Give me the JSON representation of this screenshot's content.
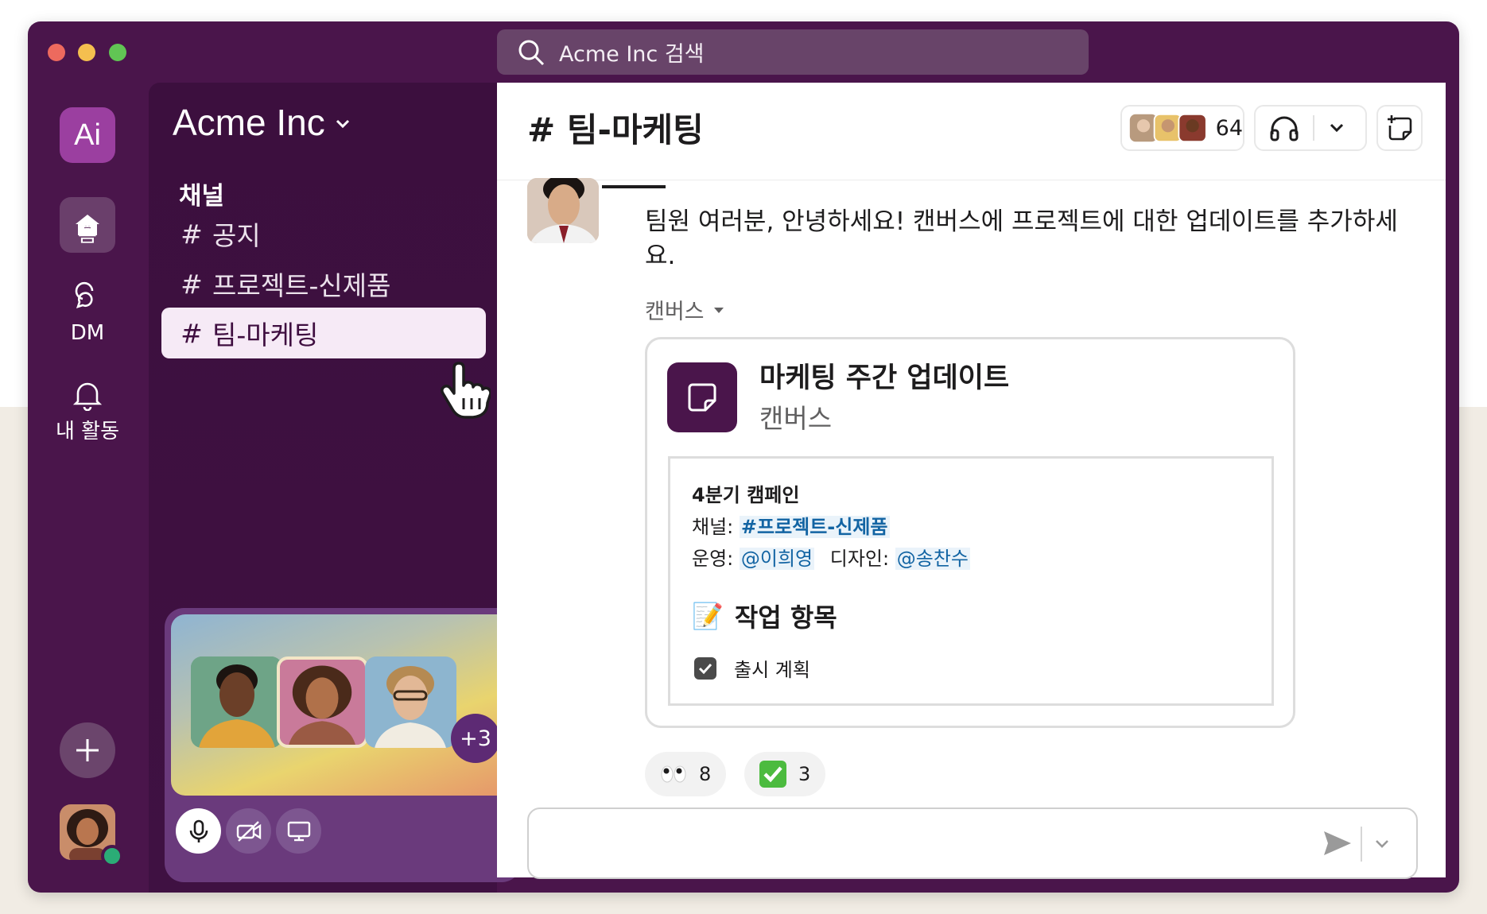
{
  "window": {
    "search_placeholder": "Acme Inc 검색"
  },
  "rail": {
    "workspace_logo": "Ai",
    "items": [
      {
        "label": "홈",
        "icon": "home-icon"
      },
      {
        "label": "DM",
        "icon": "dm-icon"
      },
      {
        "label": "내 활동",
        "icon": "bell-icon"
      }
    ],
    "add_icon": "plus-icon"
  },
  "sidebar": {
    "workspace_name": "Acme Inc",
    "section_label": "채널",
    "channels": [
      {
        "hash": "#",
        "name": "공지"
      },
      {
        "hash": "#",
        "name": "프로젝트-신제품"
      },
      {
        "hash": "#",
        "name": "팀-마케팅",
        "active": true
      }
    ]
  },
  "huddle": {
    "extra_count": "+3"
  },
  "main": {
    "channel_title": "# 팀-마케팅",
    "member_count": "64",
    "message": {
      "text": "팀원 여러분, 안녕하세요! 캔버스에 프로젝트에 대한 업데이트를 추가하세요.",
      "canvas_label": "캔버스"
    },
    "card": {
      "title": "마케팅 주간 업데이트",
      "subtitle": "캔버스",
      "doc": {
        "heading": "4분기 캠페인",
        "channel_prefix": "채널: ",
        "channel_link": "#프로젝트-신제품",
        "ops_prefix": "운영: ",
        "ops_mention": "@이희영",
        "design_prefix": "디자인: ",
        "design_mention": "@송찬수",
        "section_emoji": "📝",
        "section_title": "작업 항목",
        "task": "출시 계획"
      }
    },
    "reactions": [
      {
        "emoji": "👀",
        "count": "8"
      },
      {
        "emoji": "✅",
        "count": "3"
      }
    ]
  },
  "colors": {
    "aubergine": "#4a154b",
    "link": "#1264a3"
  }
}
